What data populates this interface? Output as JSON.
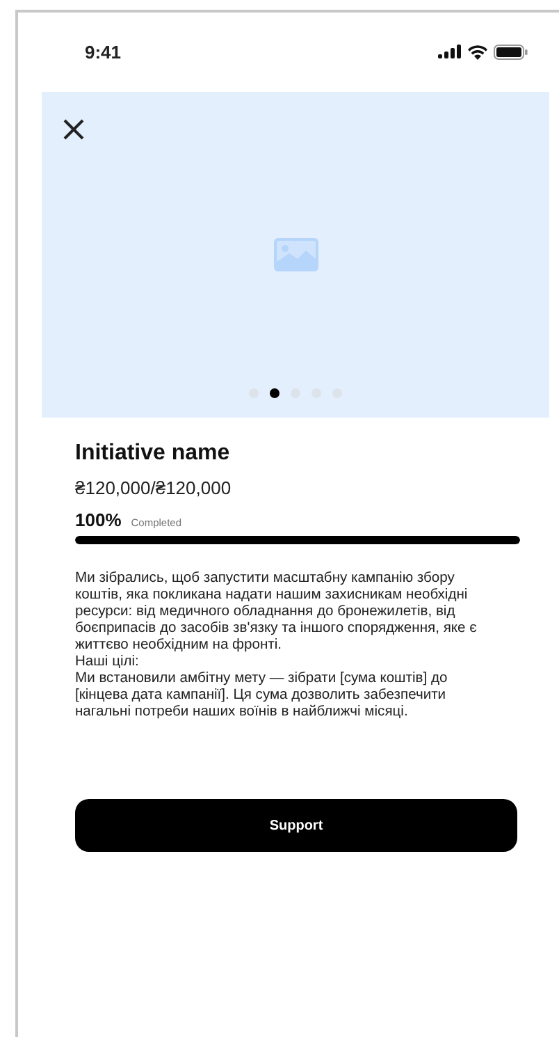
{
  "status_bar": {
    "time": "9:41"
  },
  "carousel": {
    "dots": [
      {
        "selected": false
      },
      {
        "selected": true
      },
      {
        "selected": false
      },
      {
        "selected": false
      },
      {
        "selected": false
      }
    ]
  },
  "initiative": {
    "title": "Initiative name",
    "amount": "₴120,000/₴120,000",
    "percent": "100%",
    "percent_label": "Completed",
    "level": 1
  },
  "description": [
    "Ми зібрались, щоб запустити масштабну кампанію збору коштів, яка покликана надати нашим захисникам необхідні ресурси: від медичного обладнання до бронежилетів, від боєприпасів до засобів зв'язку та іншого спорядження, яке є життєво необхідним на фронті.",
    "Наші цілі:",
    "Ми встановили амбітну мету — зібрати [сума коштів] до [кінцева дата кампанії]. Ця сума дозволить забезпечити нагальні потреби наших воїнів в найближчі місяці."
  ],
  "support_button": {
    "label": "Support"
  }
}
